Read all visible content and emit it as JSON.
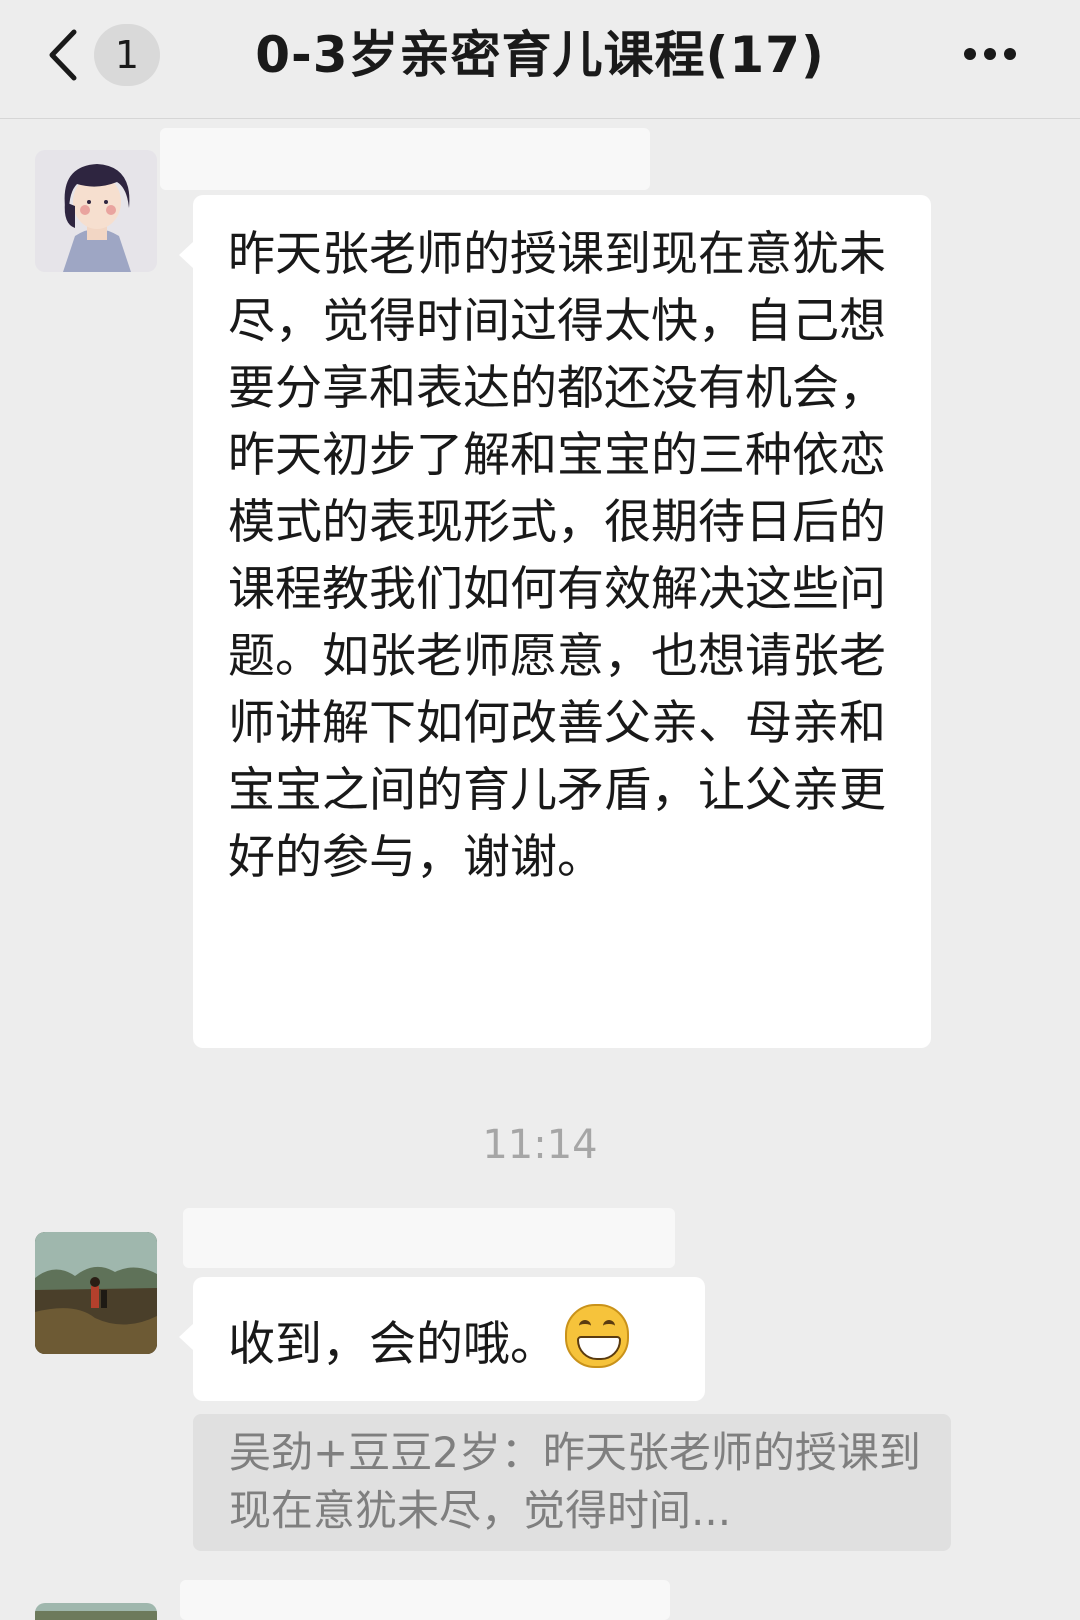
{
  "header": {
    "unread_count": "1",
    "title": "0-3岁亲密育儿课程(17)"
  },
  "messages": [
    {
      "text": "昨天张老师的授课到现在意犹未尽，觉得时间过得太快，自己想要分享和表达的都还没有机会，昨天初步了解和宝宝的三种依恋模式的表现形式，很期待日后的课程教我们如何有效解决这些问题。如张老师愿意，也想请张老师讲解下如何改善父亲、母亲和宝宝之间的育儿矛盾，让父亲更好的参与，谢谢。"
    },
    {
      "text": "收到，会的哦。",
      "emoji": "grinning-face-emoji",
      "quote": "吴劲+豆豆2岁：昨天张老师的授课到现在意犹未尽，觉得时间..."
    }
  ],
  "timestamp": "11:14",
  "colors": {
    "background": "#ededed",
    "bubble": "#ffffff",
    "quote_bg": "#e0e0e0",
    "timestamp": "#a6a6a6"
  }
}
